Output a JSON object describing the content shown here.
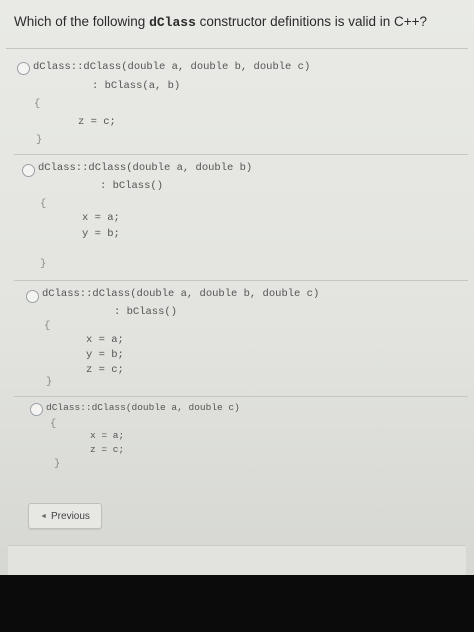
{
  "question": {
    "prefix": "Which of the following ",
    "code_word": "dClass",
    "suffix": " constructor definitions is valid in C++?"
  },
  "options": [
    {
      "lines": [
        "dClass::dClass(double a, double b, double c)",
        ": bClass(a, b)",
        "{",
        "z = c;",
        "}"
      ]
    },
    {
      "lines": [
        "dClass::dClass(double a, double b)",
        ": bClass()",
        "{",
        "x = a;",
        "y = b;",
        "}"
      ]
    },
    {
      "lines": [
        "dClass::dClass(double a, double b, double c)",
        ": bClass()",
        "{",
        "x = a;",
        "y = b;",
        "z = c;",
        "}"
      ]
    },
    {
      "lines": [
        "dClass::dClass(double a, double c)",
        "{",
        "x = a;",
        "z = c;",
        "}"
      ]
    }
  ],
  "navigation": {
    "previous_label": "Previous"
  }
}
